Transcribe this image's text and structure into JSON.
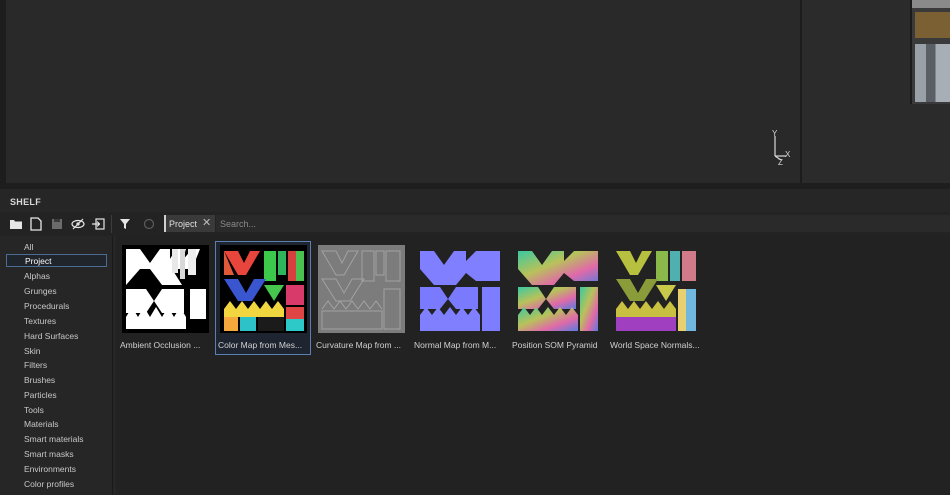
{
  "panel": {
    "title": "SHELF"
  },
  "viewport": {
    "axis": {
      "y": "Y",
      "z": "Z",
      "x": "X"
    }
  },
  "toolbar": {
    "icons": [
      "folder-icon",
      "new-file-icon",
      "save-icon",
      "hide-icon",
      "import-icon",
      "filter-icon",
      "refresh-icon"
    ],
    "active_filter": "Project",
    "search_placeholder": "Search..."
  },
  "sidebar": {
    "categories": [
      "All",
      "Project",
      "Alphas",
      "Grunges",
      "Procedurals",
      "Textures",
      "Hard Surfaces",
      "Skin",
      "Filters",
      "Brushes",
      "Particles",
      "Tools",
      "Materials",
      "Smart materials",
      "Smart masks",
      "Environments",
      "Color profiles"
    ],
    "selected": "Project"
  },
  "assets": [
    {
      "label": "Ambient Occlusion ...",
      "selected": false,
      "thumb": "ambient-occlusion-thumb"
    },
    {
      "label": "Color Map from Mes...",
      "selected": true,
      "thumb": "color-map-thumb"
    },
    {
      "label": "Curvature Map from ...",
      "selected": false,
      "thumb": "curvature-map-thumb"
    },
    {
      "label": "Normal Map from M...",
      "selected": false,
      "thumb": "normal-map-thumb"
    },
    {
      "label": "Position SOM Pyramid",
      "selected": false,
      "thumb": "position-map-thumb"
    },
    {
      "label": "World Space Normals...",
      "selected": false,
      "thumb": "world-space-normals-thumb"
    }
  ],
  "colors": {
    "accent": "#5b7fb0",
    "normal_map": "#7f7fff",
    "background": "#262626"
  }
}
